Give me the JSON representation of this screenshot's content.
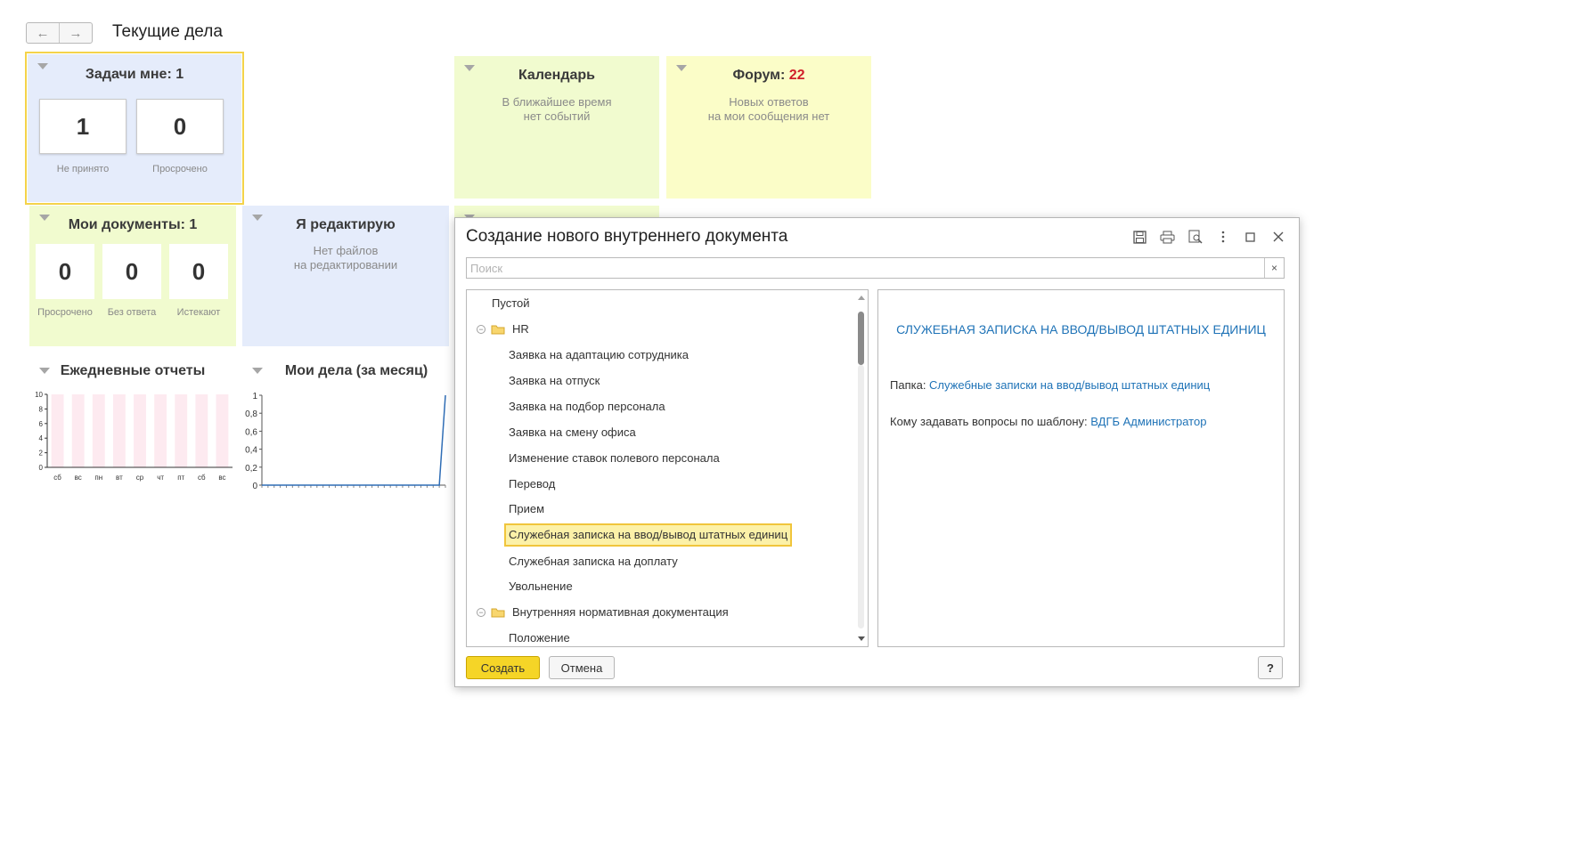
{
  "header": {
    "back_icon": "←",
    "forward_icon": "→",
    "title": "Текущие дела"
  },
  "tiles": {
    "tasks": {
      "title": "Задачи мне: 1",
      "counters": [
        {
          "value": "1",
          "caption": "Не принято"
        },
        {
          "value": "0",
          "caption": "Просрочено"
        }
      ]
    },
    "calendar": {
      "title": "Календарь",
      "line1": "В ближайшее время",
      "line2": "нет событий"
    },
    "forum": {
      "title_prefix": "Форум: ",
      "title_count": "22",
      "line1": "Новых ответов",
      "line2": "на мои сообщения нет"
    },
    "my_docs": {
      "title": "Мои документы: 1",
      "counters": [
        {
          "value": "0",
          "caption": "Просрочено"
        },
        {
          "value": "0",
          "caption": "Без ответа"
        },
        {
          "value": "0",
          "caption": "Истекают"
        }
      ]
    },
    "editing": {
      "title": "Я редактирую",
      "line1": "Нет файлов",
      "line2": "на редактировании"
    },
    "daily_reports": {
      "title": "Ежедневные отчеты"
    },
    "my_affairs": {
      "title": "Мои дела (за месяц)"
    }
  },
  "chart_data": [
    {
      "type": "bar",
      "categories": [
        "сб",
        "вс",
        "пн",
        "вт",
        "ср",
        "чт",
        "пт",
        "сб",
        "вс"
      ],
      "values": [
        0,
        0,
        0,
        0,
        0,
        0,
        0,
        0,
        0
      ],
      "yticks": [
        "0",
        "2",
        "4",
        "6",
        "8",
        "10"
      ],
      "ylim": [
        0,
        10
      ]
    },
    {
      "type": "line",
      "x_count": 31,
      "values": [
        0,
        0,
        0,
        0,
        0,
        0,
        0,
        0,
        0,
        0,
        0,
        0,
        0,
        0,
        0,
        0,
        0,
        0,
        0,
        0,
        0,
        0,
        0,
        0,
        0,
        0,
        0,
        0,
        0,
        0,
        1
      ],
      "yticks": [
        "0",
        "0,2",
        "0,4",
        "0,6",
        "0,8",
        "1"
      ],
      "ylim": [
        0,
        1
      ]
    }
  ],
  "dialog": {
    "title": "Создание нового внутреннего документа",
    "search_placeholder": "Поиск",
    "search_clear": "×",
    "tree": [
      {
        "label": "Пустой",
        "level": 0
      },
      {
        "label": "HR",
        "level": 0,
        "folder": true
      },
      {
        "label": "Заявка на адаптацию сотрудника",
        "level": 1
      },
      {
        "label": "Заявка на отпуск",
        "level": 1
      },
      {
        "label": "Заявка на подбор персонала",
        "level": 1
      },
      {
        "label": "Заявка на смену офиса",
        "level": 1
      },
      {
        "label": "Изменение ставок полевого персонала",
        "level": 1
      },
      {
        "label": "Перевод",
        "level": 1
      },
      {
        "label": "Прием",
        "level": 1
      },
      {
        "label": "Служебная записка на ввод/вывод штатных единиц",
        "level": 1,
        "selected": true
      },
      {
        "label": "Служебная записка на доплату",
        "level": 1
      },
      {
        "label": "Увольнение",
        "level": 1
      },
      {
        "label": "Внутренняя нормативная документация",
        "level": 0,
        "folder": true
      },
      {
        "label": "Положение",
        "level": 1
      }
    ],
    "preview": {
      "heading": "СЛУЖЕБНАЯ ЗАПИСКА НА ВВОД/ВЫВОД ШТАТНЫХ ЕДИНИЦ",
      "folder_label": "Папка: ",
      "folder_value": "Служебные записки на ввод/вывод штатных единиц",
      "contact_label": "Кому задавать вопросы по шаблону: ",
      "contact_value": "ВДГБ Администратор"
    },
    "buttons": {
      "create": "Создать",
      "cancel": "Отмена",
      "help": "?"
    }
  }
}
